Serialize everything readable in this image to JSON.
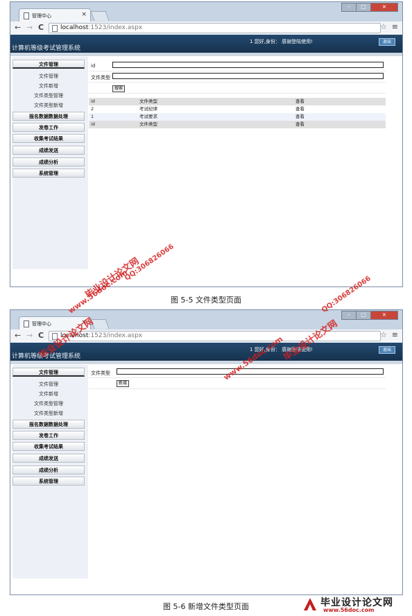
{
  "browser": {
    "tab_title": "管理中心",
    "tab_close": "×",
    "url_host": "localhost",
    "url_rest": ":1523/index.aspx",
    "nav_back": "←",
    "nav_forward": "→",
    "nav_reload": "C",
    "star": "☆",
    "menu": "≡",
    "win_min": "–",
    "win_max": "□",
    "win_close": "×"
  },
  "app": {
    "title": "计算机等级考试管理系统",
    "welcome": "1 您好,身份：   感谢登陆使用!",
    "logout": "退出"
  },
  "sidebar": {
    "file_management": "文件管理",
    "file_submenu": [
      "文件管理",
      "文件新增",
      "文件类型管理",
      "文件类型新增"
    ],
    "other_menus": [
      "报名数据数据处理",
      "发卷工作",
      "收集考试结果",
      "成绩发送",
      "成绩分析",
      "系统管理"
    ]
  },
  "screen1": {
    "search_fields": [
      {
        "label": "id",
        "value": ""
      },
      {
        "label": "文件类型",
        "value": ""
      }
    ],
    "search_button": "搜索",
    "grid": {
      "headers": [
        "id",
        "文件类型",
        "查看"
      ],
      "rows": [
        [
          "2",
          "考试纪律",
          "查看"
        ],
        [
          "1",
          "考试要求",
          "查看"
        ]
      ],
      "footer": [
        "id",
        "文件类型",
        "查看"
      ]
    },
    "caption": "图 5-5 文件类型页面"
  },
  "screen2": {
    "field_label": "文件类型",
    "field_value": "",
    "add_button": "新增",
    "caption": "图 5-6 新增文件类型页面"
  },
  "watermarks": {
    "logo": "毕业设计论文网",
    "url": "www.56doc.com",
    "qq": "QQ:306826066"
  },
  "brand": {
    "name": "毕业设计论文网",
    "url": "www.56doc.com"
  }
}
